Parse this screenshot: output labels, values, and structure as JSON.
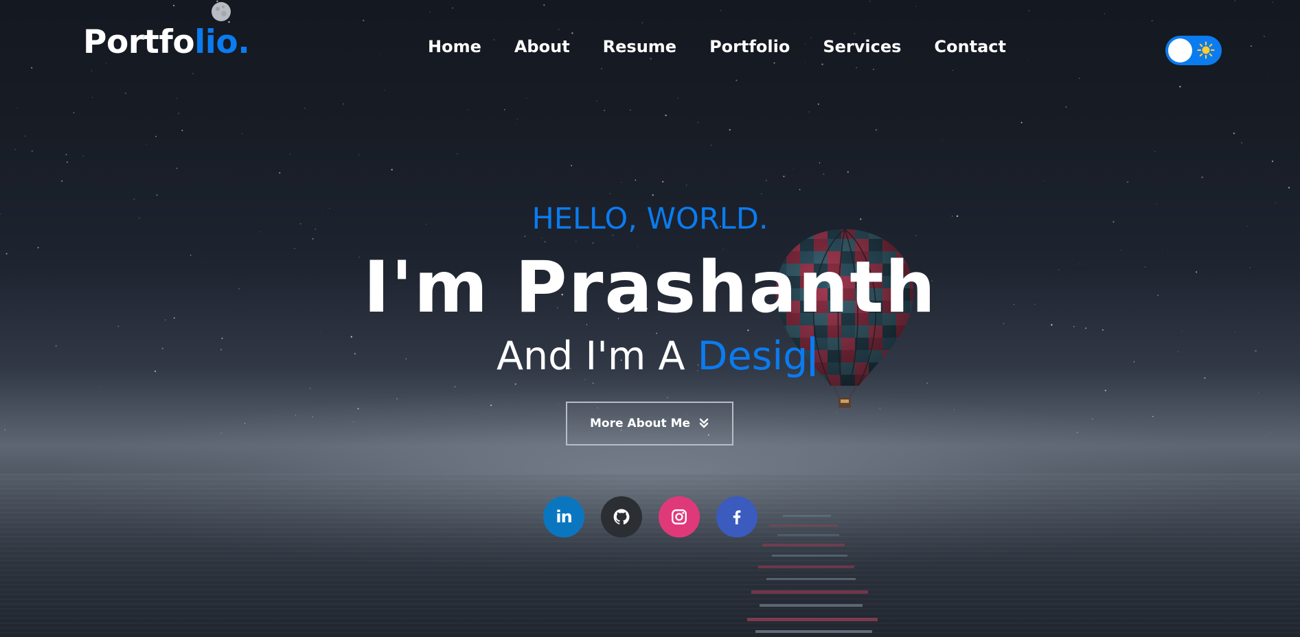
{
  "logo": {
    "text": "Portfo",
    "accent": "lio."
  },
  "nav": {
    "items": [
      {
        "label": "Home"
      },
      {
        "label": "About"
      },
      {
        "label": "Resume"
      },
      {
        "label": "Portfolio"
      },
      {
        "label": "Services"
      },
      {
        "label": "Contact"
      }
    ]
  },
  "theme_toggle": {
    "state": "on",
    "icon": "sun-icon"
  },
  "hero": {
    "greeting": "HELLO, WORLD.",
    "name": "I'm Prashanth",
    "role_prefix": "And I'm A ",
    "role_typed": "Desig",
    "button_label": "More About Me",
    "button_icon": "double-chevron-down-icon"
  },
  "socials": [
    {
      "icon": "linkedin-icon",
      "glyph": "in"
    },
    {
      "icon": "github-icon"
    },
    {
      "icon": "instagram-icon"
    },
    {
      "icon": "facebook-icon"
    }
  ],
  "colors": {
    "accent": "#0b7bf0",
    "linkedin": "#0b76c0",
    "github": "#2b2e33",
    "instagram": "#e0397a",
    "facebook": "#3b5bbf"
  }
}
